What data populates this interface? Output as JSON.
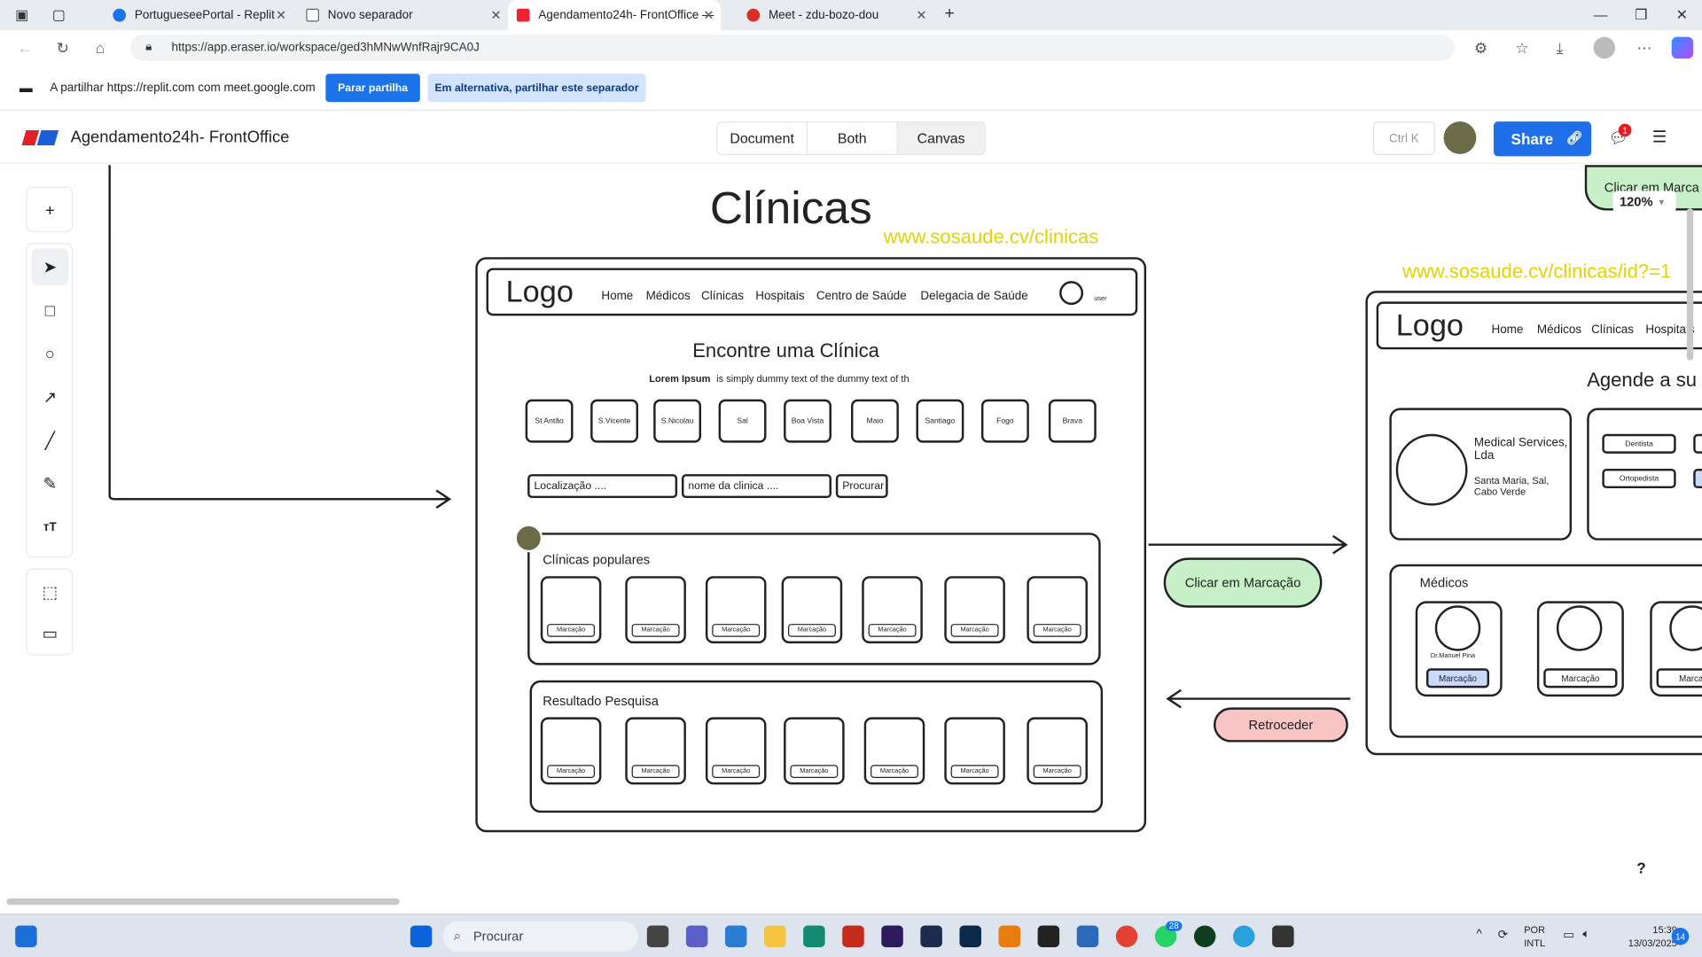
{
  "browser": {
    "tabs": [
      {
        "label": "PortugueseePortal - Replit",
        "active": false
      },
      {
        "label": "Novo separador",
        "active": false
      },
      {
        "label": "Agendamento24h- FrontOffice —",
        "active": true
      },
      {
        "label": "Meet - zdu-bozo-dou",
        "active": false
      }
    ],
    "url": "https://app.eraser.io/workspace/ged3hMNwWnfRajr9CA0J"
  },
  "sharebar": {
    "text": "A partilhar https://replit.com com meet.google.com",
    "stop_label": "Parar partilha",
    "alt_label": "Em alternativa, partilhar este separador"
  },
  "app": {
    "title": "Agendamento24h- FrontOffice",
    "views": [
      "Document",
      "Both",
      "Canvas"
    ],
    "shortcut": "Ctrl K",
    "share_label": "Share",
    "notif_count": "1",
    "zoom": "120%"
  },
  "canvas": {
    "heading": "Clínicas",
    "url1": "www.sosaude.cv/clinicas",
    "url2": "www.sosaude.cv/clinicas/id?=1",
    "top_right_label": "Clicar em Marca",
    "wire1": {
      "logo": "Logo",
      "nav": [
        "Home",
        "Médicos",
        "Clínicas",
        "Hospitais",
        "Centro de Saúde",
        "Delegacia de Saúde"
      ],
      "user": "user",
      "title": "Encontre uma Clínica",
      "lorem_bold": "Lorem Ipsum",
      "lorem_rest": "is simply dummy text of the  dummy text of th",
      "islands": [
        "St Antão",
        "S.Vicente",
        "S.Nicolau",
        "Sal",
        "Boa Vista",
        "Maio",
        "Santiago",
        "Fogo",
        "Brava"
      ],
      "loc_placeholder": "Localização ....",
      "name_placeholder": "nome da clinica ....",
      "search_btn": "Procurar",
      "popular_title": "Clínicas populares",
      "result_title": "Resultado Pesquisa",
      "card_btn": "Marcação"
    },
    "flow_next": "Clicar em Marcação",
    "flow_back": "Retroceder",
    "wire2": {
      "logo": "Logo",
      "nav": [
        "Home",
        "Médicos",
        "Clínicas",
        "Hospitais"
      ],
      "title": "Agende a su",
      "clinic_name": "Medical Services, Lda",
      "clinic_addr": "Santa Maria, Sal, Cabo Verde",
      "specialties": [
        "Dentista",
        "Ortopedista"
      ],
      "doctors_title": "Médicos",
      "doctor1": "Dr.Manuel Pina",
      "btn": "Marcação",
      "btn_cut": "Marcaç"
    },
    "help": "?"
  },
  "taskbar": {
    "search": "Procurar",
    "lang1": "POR",
    "lang2": "INTL",
    "time": "15:39",
    "date": "13/03/2025",
    "badge": "28",
    "notif": "14"
  }
}
